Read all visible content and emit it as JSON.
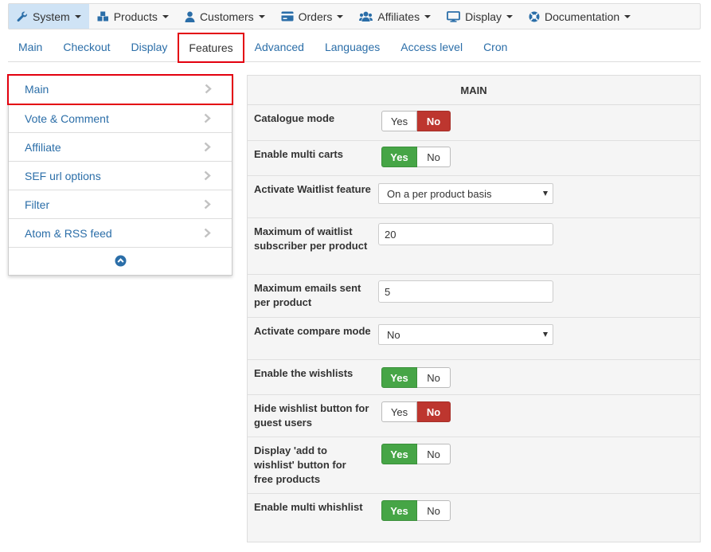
{
  "menu": {
    "items": [
      {
        "label": "System",
        "icon": "wrench-icon"
      },
      {
        "label": "Products",
        "icon": "cubes-icon"
      },
      {
        "label": "Customers",
        "icon": "user-icon"
      },
      {
        "label": "Orders",
        "icon": "credit-card-icon"
      },
      {
        "label": "Affiliates",
        "icon": "users-icon"
      },
      {
        "label": "Display",
        "icon": "monitor-icon"
      },
      {
        "label": "Documentation",
        "icon": "life-ring-icon"
      }
    ],
    "active_index": 0
  },
  "tabs": {
    "items": [
      "Main",
      "Checkout",
      "Display",
      "Features",
      "Advanced",
      "Languages",
      "Access level",
      "Cron"
    ],
    "active_index": 3
  },
  "sidenav": {
    "items": [
      "Main",
      "Vote & Comment",
      "Affiliate",
      "SEF url options",
      "Filter",
      "Atom & RSS feed"
    ],
    "active_index": 0,
    "collapse_icon": "chevron-up-circle-icon"
  },
  "panel": {
    "title": "MAIN",
    "toggle_labels": {
      "yes": "Yes",
      "no": "No"
    },
    "fields": {
      "catalogue_mode": {
        "label": "Catalogue mode",
        "value": "No"
      },
      "multi_carts": {
        "label": "Enable multi carts",
        "value": "Yes"
      },
      "waitlist": {
        "label": "Activate Waitlist feature",
        "value": "On a per product basis"
      },
      "max_waitlist": {
        "label": "Maximum of waitlist subscriber per product",
        "value": "20"
      },
      "max_emails": {
        "label": "Maximum emails sent per product",
        "value": "5"
      },
      "compare_mode": {
        "label": "Activate compare mode",
        "value": "No"
      },
      "wishlists": {
        "label": "Enable the wishlists",
        "value": "Yes"
      },
      "hide_wishlist": {
        "label": "Hide wishlist button for guest users",
        "value": "No"
      },
      "add_wishlist_free": {
        "label": "Display 'add to wishlist' button for free products",
        "value": "Yes"
      },
      "multi_wishlist": {
        "label": "Enable multi whishlist",
        "value": "Yes"
      }
    }
  },
  "colors": {
    "link": "#2b6ea8",
    "highlight": "#e3000f",
    "yes_active": "#46a546",
    "no_active": "#bd362f",
    "menu_active_bg": "#cfe3f5"
  }
}
